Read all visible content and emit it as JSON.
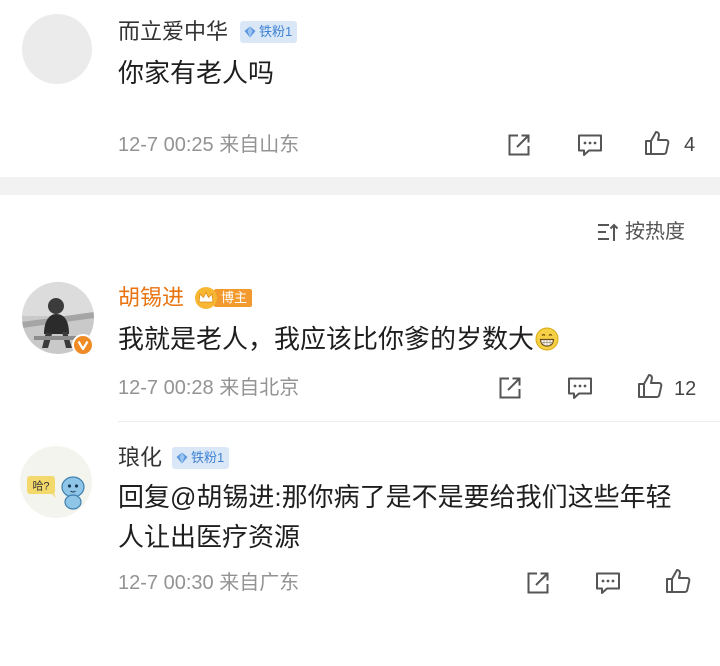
{
  "colors": {
    "username_default": "#333333",
    "username_blogger": "#e8730f",
    "meta_gray": "#939393",
    "fan_badge_bg": "#d9e7f7",
    "fan_badge_text": "#3f82d2",
    "blogger_badge_bg": "#f29a2e",
    "separator": "#f2f2f2"
  },
  "sort": {
    "label": "按热度",
    "icon": "sort-up-icon"
  },
  "comments": [
    {
      "username": "而立爱中华",
      "badge": "铁粉1",
      "badge_icon": "diamond-icon",
      "content": "你家有老人吗",
      "timestamp": "12-7 00:25",
      "location": "来自山东",
      "like_count": "4"
    },
    {
      "username": "胡锡进",
      "badge": "博主",
      "badge_icon": "crown-icon",
      "content": "我就是老人，我应该比你爹的岁数大",
      "emoji": "grin-emoji-icon",
      "timestamp": "12-7 00:28",
      "location": "来自北京",
      "like_count": "12",
      "verified_icon": "verified-v-icon"
    },
    {
      "username": "琅化",
      "badge": "铁粉1",
      "badge_icon": "diamond-icon",
      "content": "回复@胡锡进:那你病了是不是要给我们这些年轻人让出医疗资源",
      "avatar_text": "哈?",
      "timestamp": "12-7 00:30",
      "location": "来自广东",
      "like_count": ""
    }
  ]
}
